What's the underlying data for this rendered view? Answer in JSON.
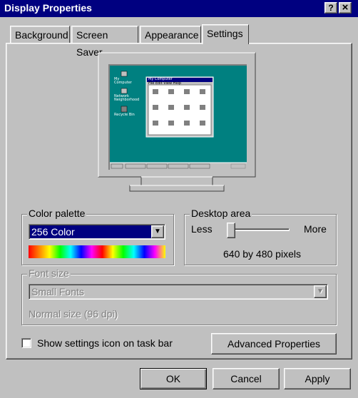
{
  "window": {
    "title": "Display Properties",
    "help_button": "?",
    "close_button": "×"
  },
  "tabs": [
    {
      "label": "Background"
    },
    {
      "label": "Screen Saver"
    },
    {
      "label": "Appearance"
    },
    {
      "label": "Settings"
    }
  ],
  "active_tab": "Settings",
  "preview": {
    "desktop_icons": [
      "My Computer",
      "Network Neighborhood",
      "Recycle Bin"
    ],
    "window_title": "My Computer",
    "window_menu": "File  Edit  View  Help",
    "colors": {
      "desktop": "#008080",
      "monitor": "#c0c0c0",
      "window_title": "#000080"
    }
  },
  "color_palette": {
    "legend": "Color palette",
    "selected": "256 Color"
  },
  "desktop_area": {
    "legend": "Desktop area",
    "less_label": "Less",
    "more_label": "More",
    "value_text": "640 by 480 pixels",
    "slider_level": 0
  },
  "font_size": {
    "legend": "Font size",
    "selected": "Small Fonts",
    "hint": "Normal size (96 dpi)"
  },
  "show_icon_checkbox": {
    "label": "Show settings icon on task bar",
    "checked": false
  },
  "advanced_button": "Advanced Properties",
  "buttons": {
    "ok": "OK",
    "cancel": "Cancel",
    "apply": "Apply"
  }
}
